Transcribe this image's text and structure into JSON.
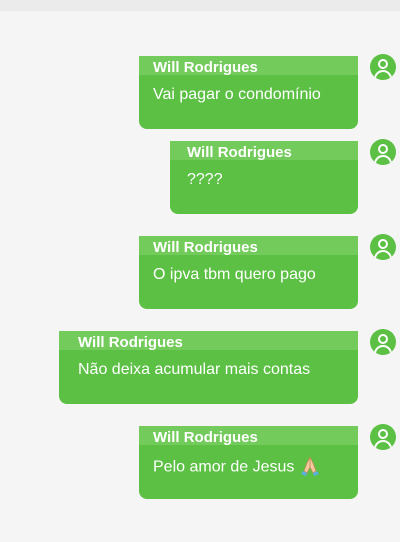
{
  "messages": [
    {
      "sender": "Will Rodrigues",
      "text": "Vai pagar o condomínio"
    },
    {
      "sender": "Will Rodrigues",
      "text": "????"
    },
    {
      "sender": "Will Rodrigues",
      "text": "O ipva tbm quero pago"
    },
    {
      "sender": "Will Rodrigues",
      "text": "Não deixa acumular mais contas"
    },
    {
      "sender": "Will Rodrigues",
      "text": "Pelo amor de Jesus",
      "emoji": "folded-hands-icon"
    }
  ],
  "colors": {
    "bubble": "#5cc044",
    "bubble_header": "#72cb5b",
    "background": "#f5f5f5"
  }
}
